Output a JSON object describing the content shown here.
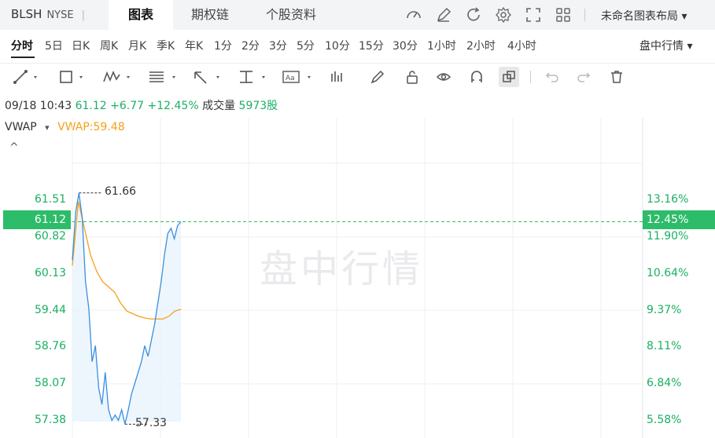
{
  "header": {
    "symbol": "BLSH",
    "exchange": "NYSE",
    "separator": "|",
    "tabs": [
      {
        "label": "图表",
        "active": true
      },
      {
        "label": "期权链",
        "active": false
      },
      {
        "label": "个股资料",
        "active": false
      }
    ],
    "icons": [
      "speedometer-icon",
      "edit-icon",
      "refresh-icon",
      "settings-icon",
      "fullscreen-icon",
      "grid-layout-icon"
    ],
    "layout_label": "未命名图表布局",
    "layout_caret": "▾"
  },
  "periods": {
    "items": [
      "分时",
      "5日",
      "日K",
      "周K",
      "月K",
      "季K",
      "年K",
      "1分",
      "2分",
      "3分",
      "5分",
      "10分",
      "15分",
      "30分",
      "1小时",
      "2小时",
      "4小时"
    ],
    "active": "分时",
    "session_label": "盘中行情",
    "session_caret": "▾"
  },
  "toolbar": {
    "tools": [
      "line-tool-icon",
      "rectangle-tool-icon",
      "pattern-tool-icon",
      "fib-tool-icon",
      "arrow-tool-icon",
      "measure-tool-icon",
      "text-tool-icon",
      "volume-bars-icon",
      "pencil-icon",
      "lock-icon",
      "eye-icon",
      "magnet-icon",
      "copy-icon",
      "undo-icon",
      "redo-icon",
      "trash-icon"
    ]
  },
  "quote": {
    "datetime": "09/18 10:43",
    "price": "61.12",
    "change": "+6.77",
    "change_pct": "+12.45%",
    "volume_label": "成交量",
    "volume": "5973股"
  },
  "indicator": {
    "name": "VWAP",
    "caret": "▾",
    "value_text": "VWAP:59.48",
    "collapse_icon": "^"
  },
  "chart_data": {
    "type": "line",
    "watermark": "盘中行情",
    "y_left_ticks": [
      "61.51",
      "60.82",
      "60.13",
      "59.44",
      "58.76",
      "58.07",
      "57.38"
    ],
    "y_right_ticks": [
      "13.16%",
      "11.90%",
      "10.64%",
      "9.37%",
      "8.11%",
      "6.84%",
      "5.58%"
    ],
    "ylim": [
      57.38,
      61.51
    ],
    "current_price": "61.12",
    "current_pct": "12.45%",
    "high_label": "61.66",
    "low_label": "57.33",
    "colors": {
      "price": "#3a8fe0",
      "vwap": "#f5a01a",
      "up": "#1aaf63"
    },
    "series": [
      {
        "name": "price",
        "values": [
          60.4,
          61.3,
          61.66,
          61.2,
          60.0,
          59.5,
          58.5,
          58.8,
          58.0,
          57.7,
          58.3,
          57.6,
          57.4,
          57.5,
          57.4,
          57.6,
          57.33,
          57.6,
          57.9,
          58.1,
          58.3,
          58.5,
          58.8,
          58.6,
          58.9,
          59.2,
          59.6,
          60.0,
          60.5,
          60.9,
          61.0,
          60.8,
          61.05,
          61.12
        ]
      },
      {
        "name": "VWAP",
        "values": [
          60.3,
          61.5,
          61.0,
          60.5,
          60.2,
          60.0,
          59.9,
          59.8,
          59.6,
          59.45,
          59.4,
          59.35,
          59.32,
          59.3,
          59.3,
          59.3,
          59.35,
          59.45,
          59.48
        ]
      }
    ]
  }
}
